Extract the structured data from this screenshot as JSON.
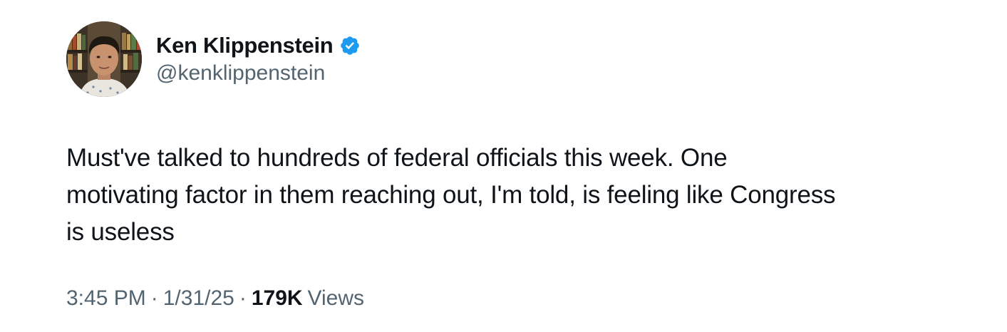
{
  "author": {
    "display_name": "Ken Klippenstein",
    "handle": "@kenklippenstein",
    "verified": true,
    "verified_color": "#1d9bf0",
    "avatar_icon": "profile-photo"
  },
  "tweet": {
    "text_lines": [
      "Must've talked to hundreds of federal officials this week. One",
      "motivating factor in them reaching out, I'm told, is feeling like Congress",
      "is useless"
    ]
  },
  "meta": {
    "time": "3:45 PM",
    "date": "1/31/25",
    "separator": "·",
    "views_count": "179K",
    "views_label": "Views"
  },
  "colors": {
    "text_primary": "#0f1419",
    "text_secondary": "#536471",
    "background": "#ffffff"
  }
}
